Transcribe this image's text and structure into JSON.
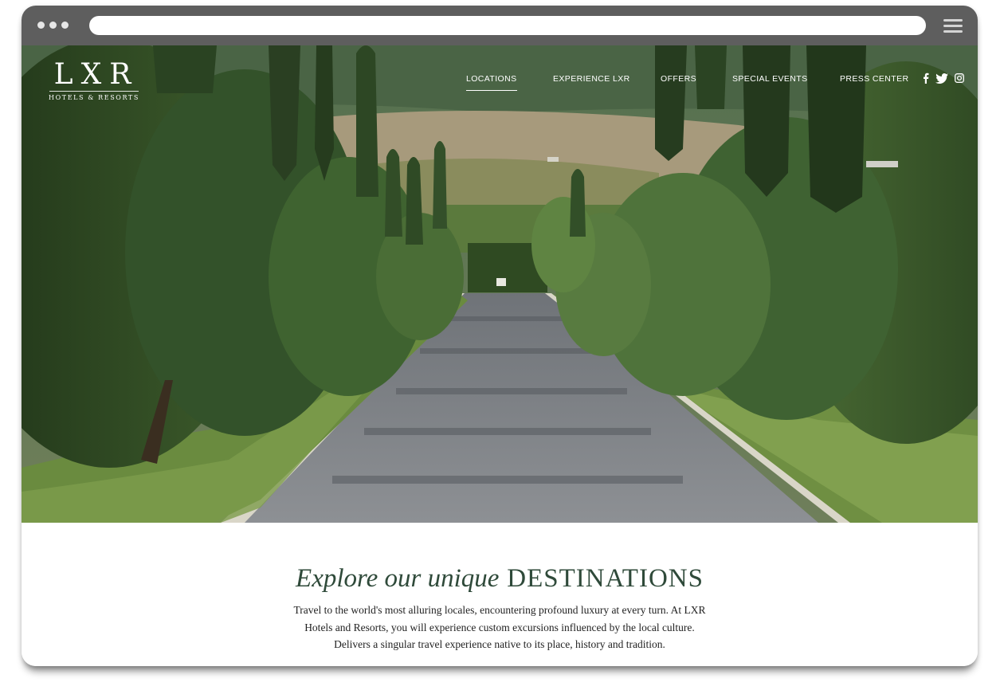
{
  "brand": {
    "logo_mark": "LXR",
    "logo_sub": "HOTELS & RESORTS"
  },
  "nav": {
    "items": [
      {
        "label": "LOCATIONS",
        "active": true
      },
      {
        "label": "EXPERIENCE LXR",
        "active": false
      },
      {
        "label": "OFFERS",
        "active": false
      },
      {
        "label": "SPECIAL EVENTS",
        "active": false
      },
      {
        "label": "PRESS CENTER",
        "active": false
      }
    ]
  },
  "social": [
    "facebook-icon",
    "twitter-icon",
    "instagram-icon"
  ],
  "intro": {
    "headline_italic": "Explore our unique",
    "headline_caps": "DESTINATIONS",
    "body_lines": [
      "Travel to the world's most alluring locales, encountering profound luxury at every turn. At LXR",
      "Hotels and Resorts, you will experience custom excursions influenced by the local culture.",
      "Delivers a singular travel experience native to its place, history and tradition."
    ]
  },
  "colors": {
    "headline": "#2f4a3a",
    "chrome": "#5e5e5e"
  }
}
